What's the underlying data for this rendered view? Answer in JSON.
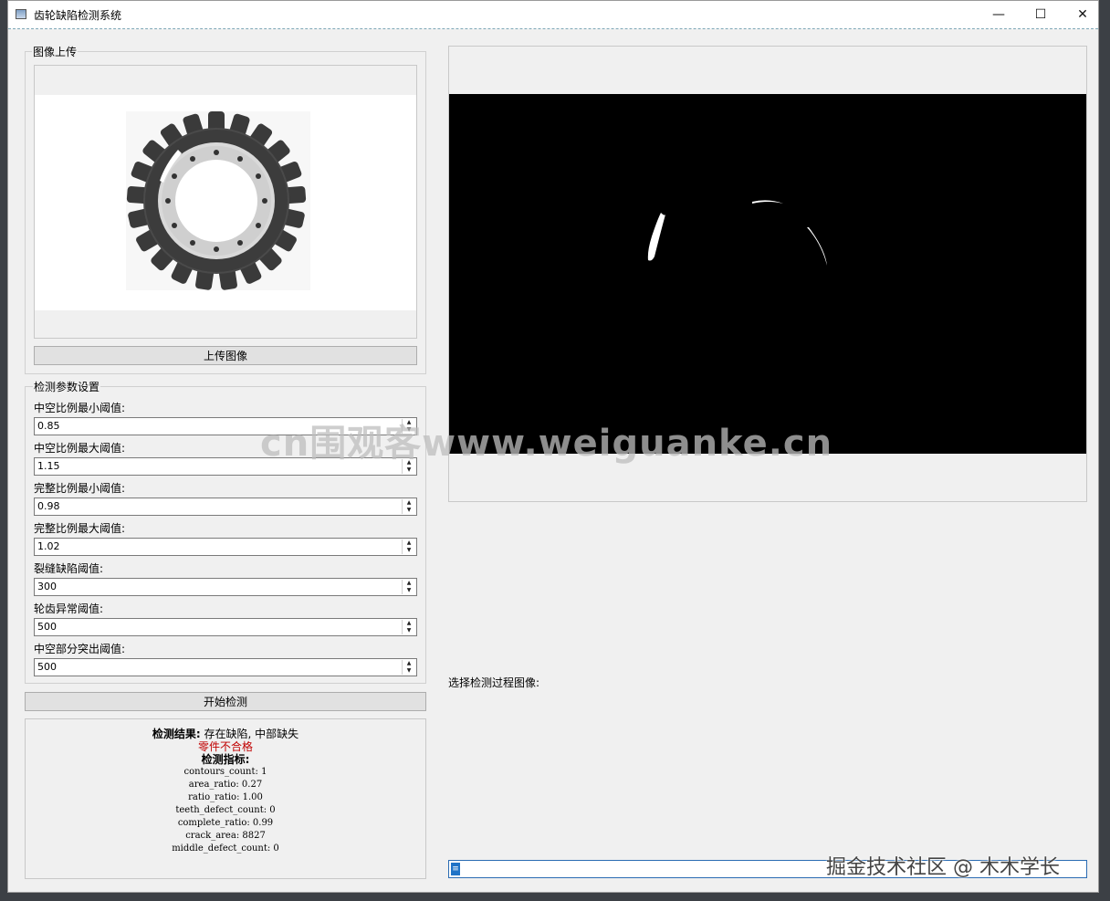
{
  "window": {
    "title": "齿轮缺陷检测系统",
    "minimize_glyph": "—",
    "maximize_glyph": "☐",
    "close_glyph": "✕"
  },
  "upload_group": {
    "title": "图像上传",
    "upload_button": "上传图像"
  },
  "params_group": {
    "title": "检测参数设置",
    "fields": [
      {
        "label": "中空比例最小阈值:",
        "value": "0.85"
      },
      {
        "label": "中空比例最大阈值:",
        "value": "1.15"
      },
      {
        "label": "完整比例最小阈值:",
        "value": "0.98"
      },
      {
        "label": "完整比例最大阈值:",
        "value": "1.02"
      },
      {
        "label": "裂缝缺陷阈值:",
        "value": "300"
      },
      {
        "label": "轮齿异常阈值:",
        "value": "500"
      },
      {
        "label": "中空部分突出阈值:",
        "value": "500"
      }
    ]
  },
  "start_button": "开始检测",
  "result": {
    "heading": "检测结果:",
    "text": " 存在缺陷, 中部缺失",
    "verdict": "零件不合格",
    "verdict_color": "#c00000",
    "metrics_heading": "检测指标:",
    "metrics": [
      "contours_count: 1",
      "area_ratio: 0.27",
      "ratio_ratio: 1.00",
      "teeth_defect_count: 0",
      "complete_ratio: 0.99",
      "crack_area: 8827",
      "middle_defect_count: 0"
    ]
  },
  "process": {
    "select_label": "选择检测过程图像:",
    "combo_value": "",
    "combo_indicator": "≡"
  },
  "watermarks": {
    "center": "cn围观客www.weiguanke.cn",
    "bottom_right": "掘金技术社区 @ 木木学长"
  }
}
